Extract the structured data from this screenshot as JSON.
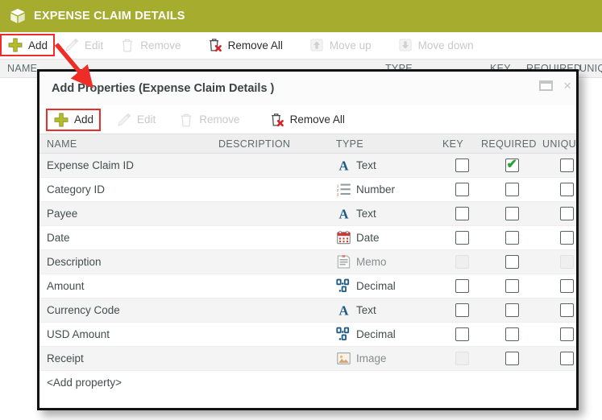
{
  "app": {
    "header": {
      "title": "EXPENSE CLAIM DETAILS",
      "icon": "cube-icon",
      "bg_color": "#a6ad2e",
      "text_color": "#ffffff"
    },
    "toolbar": {
      "buttons": [
        {
          "label": "Add",
          "icon": "plus-icon",
          "enabled": true,
          "highlighted": true
        },
        {
          "label": "Edit",
          "icon": "pencil-icon",
          "enabled": false,
          "highlighted": false
        },
        {
          "label": "Remove",
          "icon": "trash-icon",
          "enabled": false,
          "highlighted": false
        },
        {
          "label": "Remove All",
          "icon": "trash-x-icon",
          "enabled": true,
          "highlighted": false
        },
        {
          "label": "Move up",
          "icon": "arrow-up-icon",
          "enabled": false,
          "highlighted": false
        },
        {
          "label": "Move down",
          "icon": "arrow-down-icon",
          "enabled": false,
          "highlighted": false
        }
      ]
    },
    "column_headers": [
      "NAME",
      "TYPE",
      "KEY",
      "REQUIRED",
      "UNIQUE"
    ]
  },
  "dialog": {
    "title": "Add Properties (Expense Claim Details )",
    "window_controls": [
      {
        "name": "maximize-button",
        "glyph": "▭"
      },
      {
        "name": "close-button",
        "glyph": "×"
      }
    ],
    "toolbar": {
      "buttons": [
        {
          "label": "Add",
          "icon": "plus-icon",
          "enabled": true,
          "highlighted": true
        },
        {
          "label": "Edit",
          "icon": "pencil-icon",
          "enabled": false,
          "highlighted": false
        },
        {
          "label": "Remove",
          "icon": "trash-icon",
          "enabled": false,
          "highlighted": false
        },
        {
          "label": "Remove All",
          "icon": "trash-x-icon",
          "enabled": true,
          "highlighted": false
        }
      ]
    },
    "table": {
      "columns": [
        "NAME",
        "DESCRIPTION",
        "TYPE",
        "KEY",
        "REQUIRED",
        "UNIQUE"
      ],
      "rows": [
        {
          "name": "Expense Claim ID",
          "description": "",
          "type": "Text",
          "type_icon": "text-A-icon",
          "key": false,
          "key_enabled": true,
          "required": true,
          "required_enabled": true,
          "unique": false,
          "unique_enabled": true
        },
        {
          "name": "Category ID",
          "description": "",
          "type": "Number",
          "type_icon": "number-list-icon",
          "key": false,
          "key_enabled": true,
          "required": false,
          "required_enabled": true,
          "unique": false,
          "unique_enabled": true
        },
        {
          "name": "Payee",
          "description": "",
          "type": "Text",
          "type_icon": "text-A-icon",
          "key": false,
          "key_enabled": true,
          "required": false,
          "required_enabled": true,
          "unique": false,
          "unique_enabled": true
        },
        {
          "name": "Date",
          "description": "",
          "type": "Date",
          "type_icon": "calendar-icon",
          "key": false,
          "key_enabled": true,
          "required": false,
          "required_enabled": true,
          "unique": false,
          "unique_enabled": true
        },
        {
          "name": "Description",
          "description": "",
          "type": "Memo",
          "type_icon": "memo-icon",
          "key": false,
          "key_enabled": false,
          "required": false,
          "required_enabled": true,
          "unique": false,
          "unique_enabled": false
        },
        {
          "name": "Amount",
          "description": "",
          "type": "Decimal",
          "type_icon": "decimal-icon",
          "key": false,
          "key_enabled": true,
          "required": false,
          "required_enabled": true,
          "unique": false,
          "unique_enabled": true
        },
        {
          "name": "Currency Code",
          "description": "",
          "type": "Text",
          "type_icon": "text-A-icon",
          "key": false,
          "key_enabled": true,
          "required": false,
          "required_enabled": true,
          "unique": false,
          "unique_enabled": true
        },
        {
          "name": "USD Amount",
          "description": "",
          "type": "Decimal",
          "type_icon": "decimal-icon",
          "key": false,
          "key_enabled": true,
          "required": false,
          "required_enabled": true,
          "unique": false,
          "unique_enabled": true
        },
        {
          "name": "Receipt",
          "description": "",
          "type": "Image",
          "type_icon": "image-icon",
          "key": false,
          "key_enabled": false,
          "required": false,
          "required_enabled": true,
          "unique": false,
          "unique_enabled": true
        }
      ],
      "add_row_placeholder": "<Add property>"
    }
  },
  "annotations": {
    "arrow_color": "#ee2d26",
    "highlight_box_color": "#ef2c2c"
  }
}
